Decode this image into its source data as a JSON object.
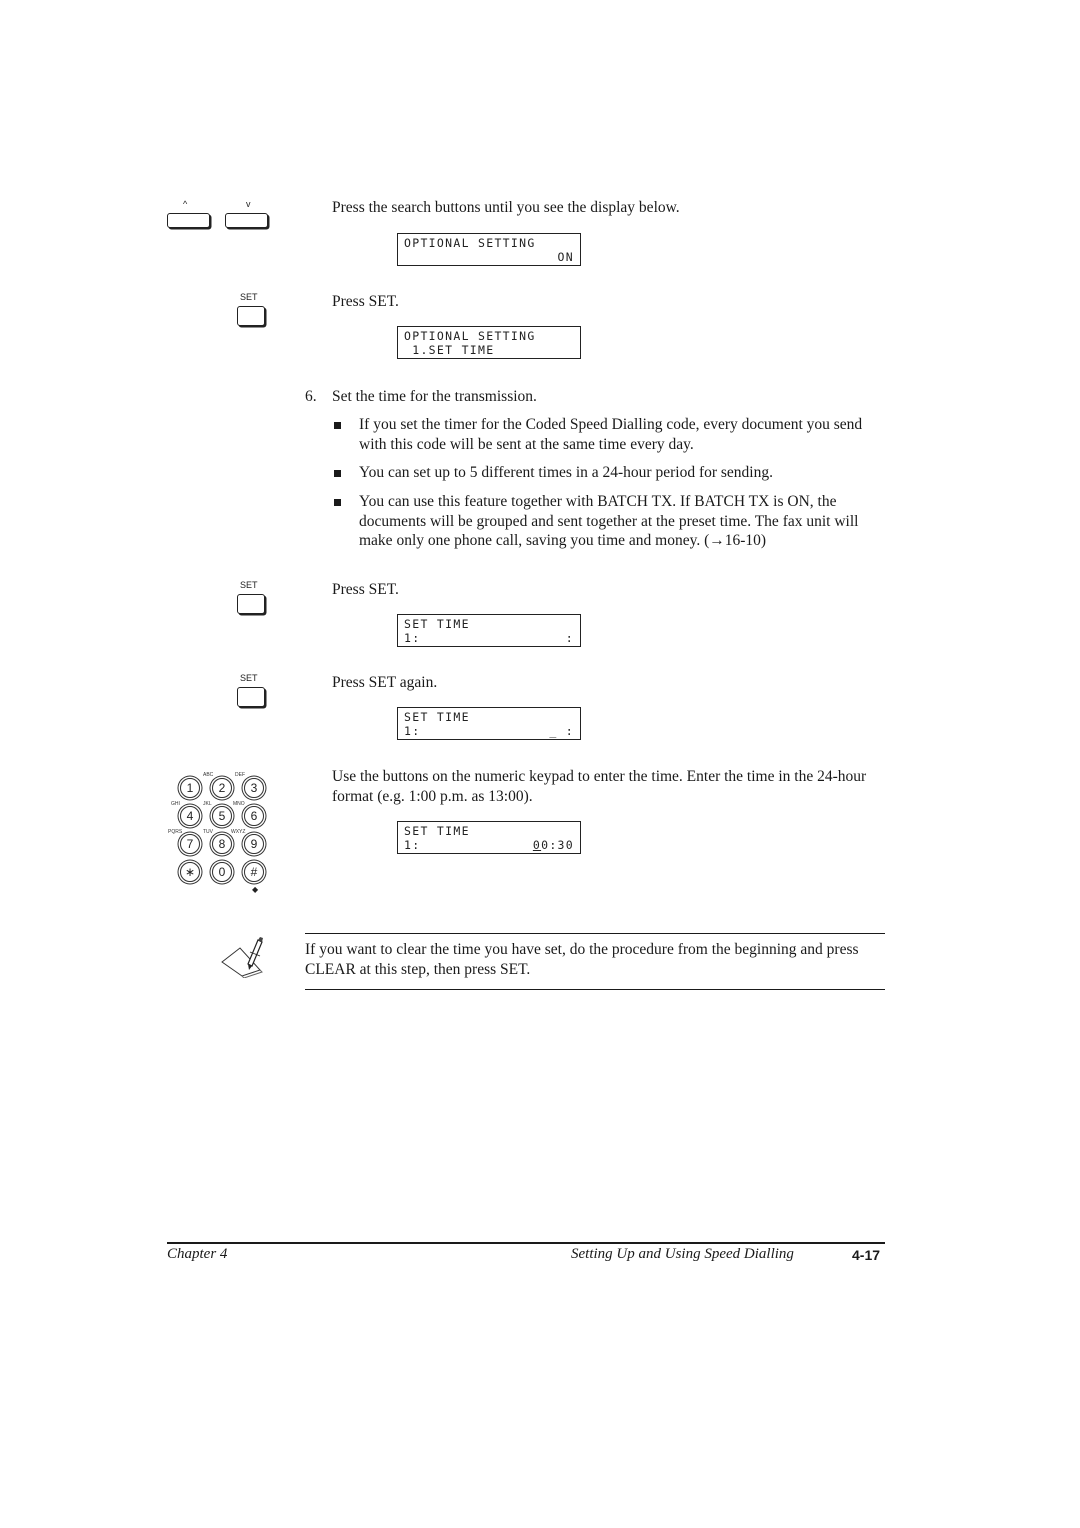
{
  "step_search": {
    "up_key_label": "^",
    "down_key_label": "v",
    "instruction": "Press the search buttons until you see the display below.",
    "display": {
      "line1_left": "OPTIONAL SETTING",
      "line1_right": "",
      "line2_left": "",
      "line2_right": "ON"
    }
  },
  "step_set1": {
    "key_label": "SET",
    "instruction": "Press SET.",
    "display": {
      "line1_left": "OPTIONAL SETTING",
      "line1_right": "",
      "line2_left": " 1.SET TIME",
      "line2_right": ""
    }
  },
  "step6": {
    "number": "6.",
    "title": "Set the time for the transmission.",
    "bullets": [
      "If you set the timer for the Coded Speed Dialling code, every document you send with this code will be sent at the same time every day.",
      "You can set up to 5 different times in a 24-hour period for sending.",
      "You can use this feature together with BATCH TX. If BATCH TX is ON, the documents will be grouped and sent together at the preset time. The fax unit will make only one phone call, saving you time and money. (→16-10)"
    ]
  },
  "step_set2": {
    "key_label": "SET",
    "instruction": "Press SET.",
    "display": {
      "line1_left": "SET TIME",
      "line1_right": "",
      "line2_left": "1:",
      "line2_right": ":"
    }
  },
  "step_set3": {
    "key_label": "SET",
    "instruction": "Press SET again.",
    "display": {
      "line1_left": "SET TIME",
      "line1_right": "",
      "line2_left": "1:",
      "line2_right": "_ :"
    }
  },
  "step_keypad": {
    "instruction": "Use the buttons on the numeric keypad to enter the time. Enter the time in the 24-hour format (e.g. 1:00 p.m. as 13:00).",
    "keys": [
      "1",
      "2",
      "3",
      "4",
      "5",
      "6",
      "7",
      "8",
      "9",
      "∗",
      "0",
      "#"
    ],
    "letters": [
      "",
      "ABC",
      "DEF",
      "GHI",
      "JKL",
      "MNO",
      "PQRS",
      "TUV",
      "WXYZ",
      "",
      "",
      ""
    ],
    "display": {
      "line1_left": "SET TIME",
      "line2_left": "1:",
      "line2_cursor": "0",
      "line2_right": "0:30"
    }
  },
  "note": {
    "icon": "pencil-note-icon",
    "text": "If you want to clear the time you have set, do the procedure from the beginning and press CLEAR at this step, then press SET."
  },
  "footer": {
    "chapter": "Chapter 4",
    "section": "Setting Up and Using Speed Dialling",
    "page": "4-17"
  }
}
